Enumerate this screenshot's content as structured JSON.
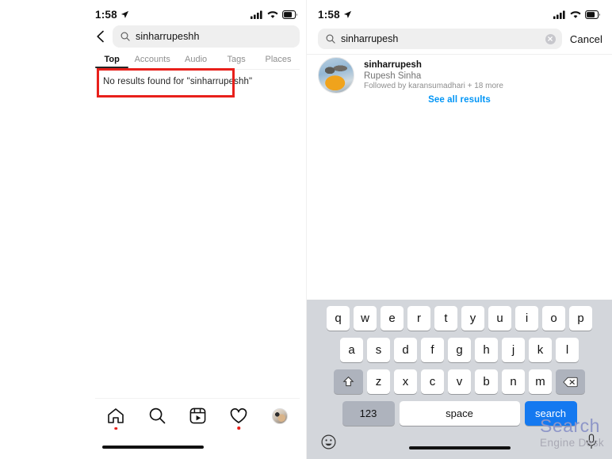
{
  "statusbar": {
    "time": "1:58",
    "icons": [
      "cellular-icon",
      "wifi-icon",
      "battery-icon",
      "location-arrow-icon"
    ]
  },
  "left_panel": {
    "back_icon": "back-chevron-icon",
    "search": {
      "icon": "search-icon",
      "value": "sinharrupeshh"
    },
    "tabs": [
      {
        "label": "Top",
        "active": true
      },
      {
        "label": "Accounts",
        "active": false
      },
      {
        "label": "Audio",
        "active": false
      },
      {
        "label": "Tags",
        "active": false
      },
      {
        "label": "Places",
        "active": false
      }
    ],
    "no_results_text": "No results found for \"sinharrupeshh\"",
    "annotation": {
      "color": "#e8201b",
      "shape": "rectangle"
    },
    "bottom_nav": [
      {
        "name": "home",
        "icon": "home-icon",
        "badge_dot": true
      },
      {
        "name": "search",
        "icon": "search-icon",
        "badge_dot": false
      },
      {
        "name": "reels",
        "icon": "reels-icon",
        "badge_dot": false
      },
      {
        "name": "activity",
        "icon": "heart-icon",
        "badge_dot": true
      },
      {
        "name": "profile",
        "icon": "avatar-icon",
        "badge_dot": false
      }
    ]
  },
  "right_panel": {
    "search": {
      "icon": "search-icon",
      "value": "sinharrupesh",
      "clear_label": "×",
      "cancel_label": "Cancel"
    },
    "result": {
      "username": "sinharrupesh",
      "full_name": "Rupesh Sinha",
      "followed_by": "Followed by karansumadhari + 18 more"
    },
    "see_all_label": "See all results",
    "see_all_color": "#0095f6"
  },
  "keyboard": {
    "row1": [
      "q",
      "w",
      "e",
      "r",
      "t",
      "y",
      "u",
      "i",
      "o",
      "p"
    ],
    "row2": [
      "a",
      "s",
      "d",
      "f",
      "g",
      "h",
      "j",
      "k",
      "l"
    ],
    "row3": [
      "z",
      "x",
      "c",
      "v",
      "b",
      "n",
      "m"
    ],
    "shift_icon": "shift-icon",
    "backspace_icon": "backspace-icon",
    "numbers_label": "123",
    "space_label": "space",
    "search_label": "search",
    "emoji_icon": "emoji-icon",
    "mic_icon": "microphone-icon",
    "accent_color": "#1479f0"
  },
  "watermark": {
    "line1": "Search",
    "line2": "Engine Desk"
  }
}
